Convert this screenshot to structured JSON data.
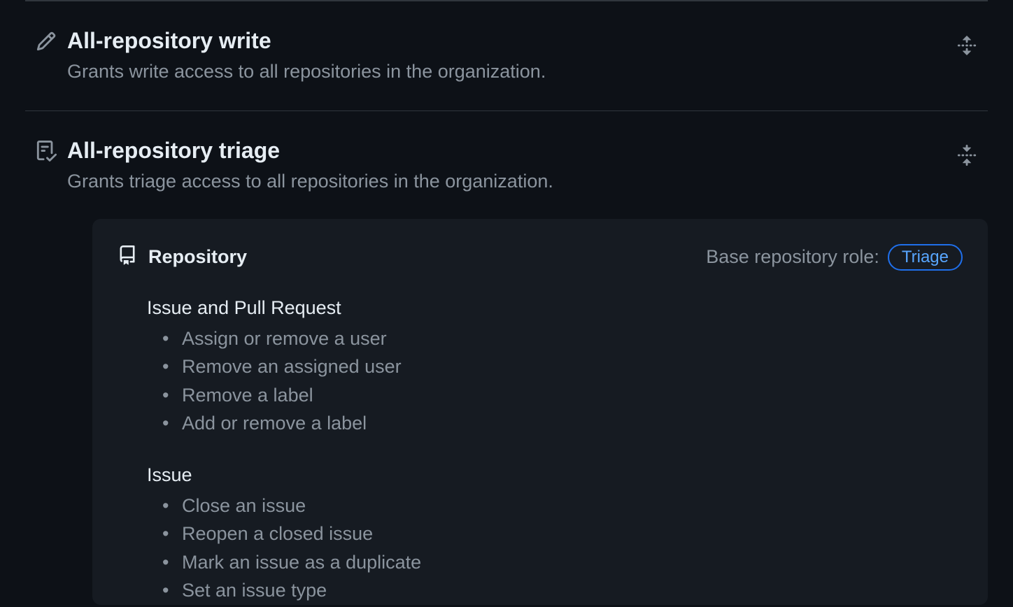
{
  "roles": [
    {
      "title": "All-repository write",
      "description": "Grants write access to all repositories in the organization."
    },
    {
      "title": "All-repository triage",
      "description": "Grants triage access to all repositories in the organization."
    }
  ],
  "details": {
    "section_title": "Repository",
    "base_role_label": "Base repository role:",
    "base_role_badge": "Triage",
    "groups": [
      {
        "name": "Issue and Pull Request",
        "items": [
          "Assign or remove a user",
          "Remove an assigned user",
          "Remove a label",
          "Add or remove a label"
        ]
      },
      {
        "name": "Issue",
        "items": [
          "Close an issue",
          "Reopen a closed issue",
          "Mark an issue as a duplicate",
          "Set an issue type"
        ]
      }
    ]
  }
}
